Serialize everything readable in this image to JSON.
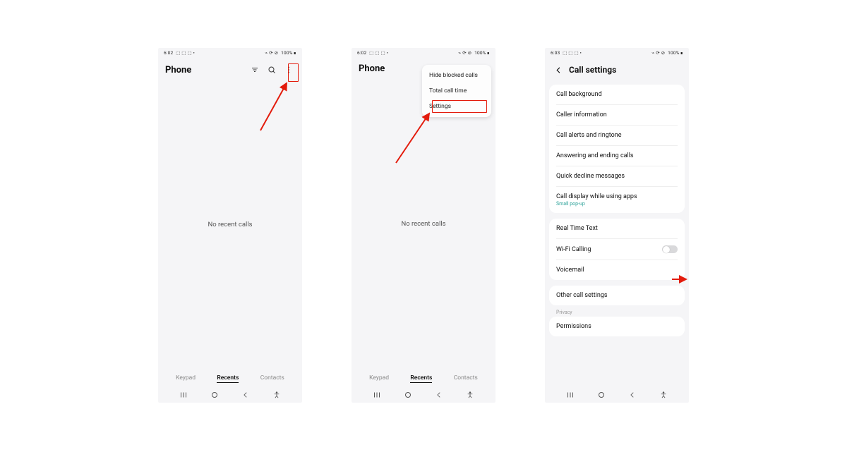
{
  "status": {
    "time1": "6:02",
    "time3": "6:03",
    "battery": "100%",
    "icons_left": "⬚ ⬚ ⬚ •",
    "icons_right": "⌁ ⟳ ⊘"
  },
  "phone1": {
    "title": "Phone",
    "empty": "No recent calls",
    "tabs": [
      "Keypad",
      "Recents",
      "Contacts"
    ]
  },
  "phone2": {
    "title": "Phone",
    "empty": "No recent calls",
    "tabs": [
      "Keypad",
      "Recents",
      "Contacts"
    ],
    "menu": [
      "Hide blocked calls",
      "Total call time",
      "Settings"
    ]
  },
  "phone3": {
    "title": "Call settings",
    "group1": [
      {
        "label": "Call background"
      },
      {
        "label": "Caller information"
      },
      {
        "label": "Call alerts and ringtone"
      },
      {
        "label": "Answering and ending calls"
      },
      {
        "label": "Quick decline messages"
      },
      {
        "label": "Call display while using apps",
        "sub": "Small pop-up"
      }
    ],
    "group2": [
      {
        "label": "Real Time Text"
      },
      {
        "label": "Wi-Fi Calling",
        "toggle": true
      },
      {
        "label": "Voicemail"
      }
    ],
    "group3": [
      {
        "label": "Other call settings"
      }
    ],
    "privacy_label": "Privacy",
    "group4": [
      {
        "label": "Permissions"
      }
    ]
  }
}
